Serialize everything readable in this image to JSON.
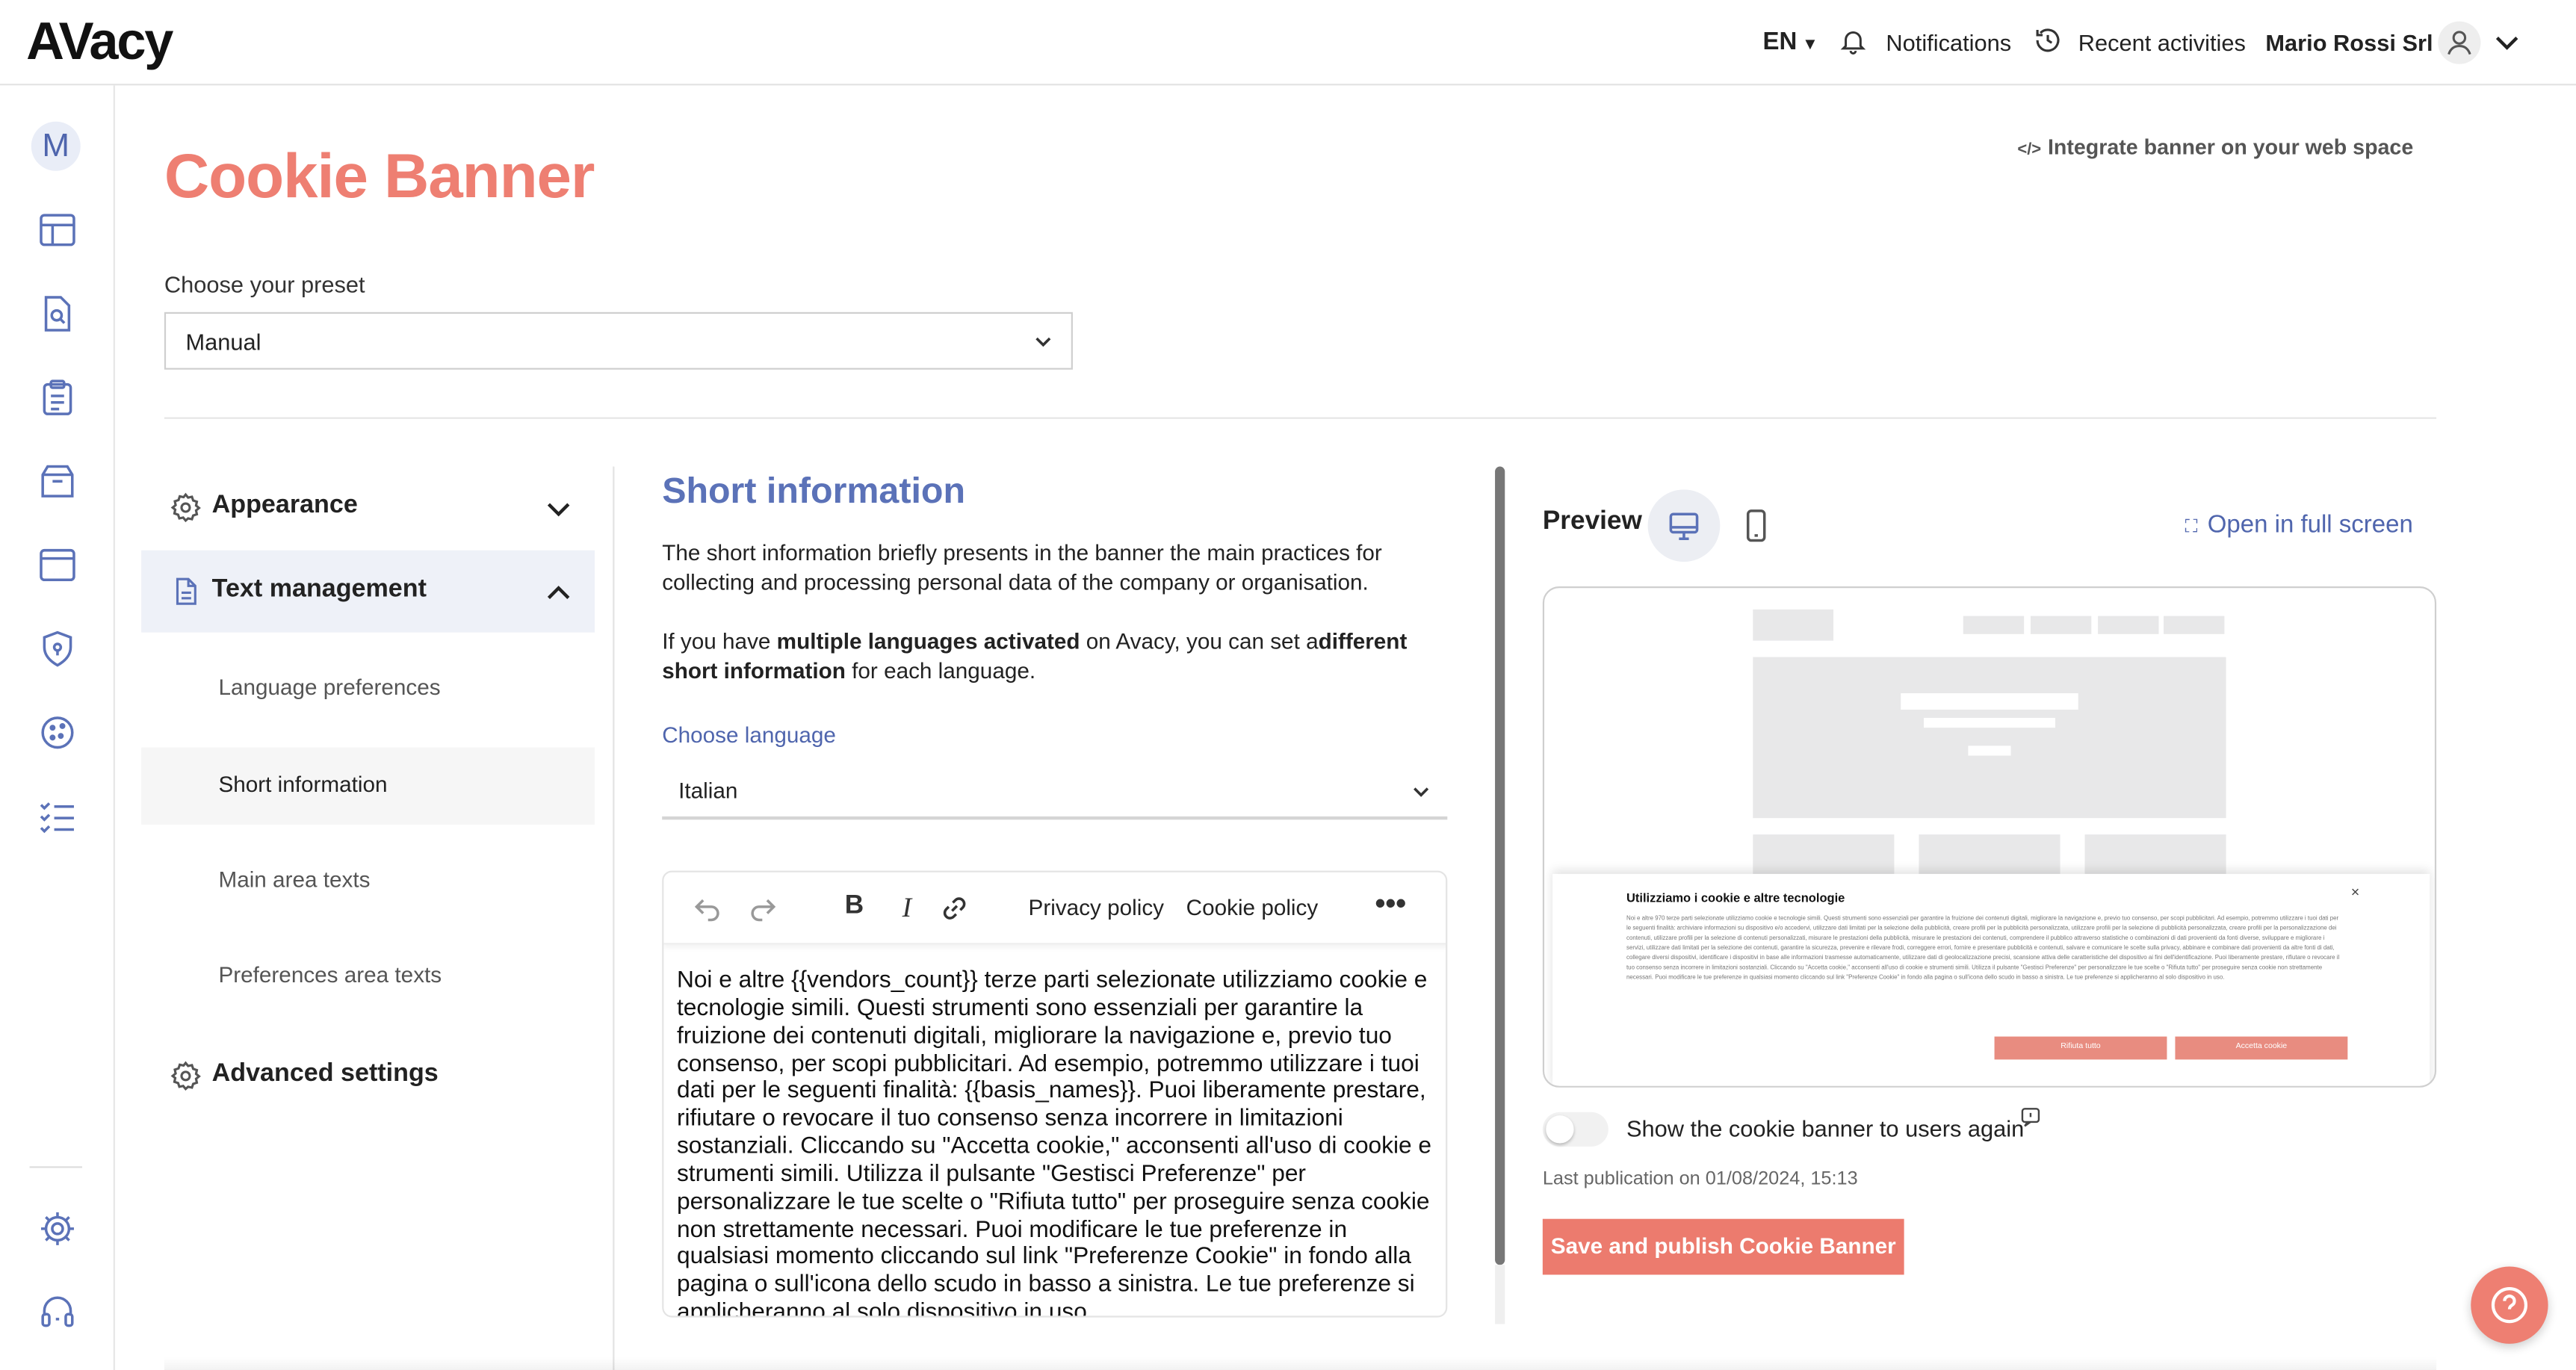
{
  "app": {
    "logo": "AVacy"
  },
  "topbar": {
    "language": "EN",
    "notifications": "Notifications",
    "recent_activities": "Recent activities",
    "company": "Mario Rossi Srl"
  },
  "sidebar": {
    "avatar_letter": "M",
    "icons": [
      "dashboard-icon",
      "document-search-icon",
      "clipboard-list-icon",
      "box-icon",
      "browser-window-icon",
      "shield-icon",
      "cookie-icon",
      "checklist-icon",
      "settings-icon",
      "headset-icon"
    ]
  },
  "page": {
    "title": "Cookie Banner",
    "integrate_link": "Integrate banner on your web space",
    "preset_label": "Choose your preset",
    "preset_value": "Manual"
  },
  "menu": {
    "appearance": "Appearance",
    "text_management": "Text management",
    "items": [
      "Language preferences",
      "Short information",
      "Main area texts",
      "Preferences area texts"
    ],
    "advanced_settings": "Advanced settings"
  },
  "short_info": {
    "title": "Short information",
    "desc": "The short information briefly presents in the banner the main practices for collecting and processing personal data of the company or organisation.",
    "multi_pre": "If you have ",
    "multi_bold1": "multiple languages activated",
    "multi_mid": " on Avacy, you can set a",
    "multi_bold2": "different short information",
    "multi_post": " for each language.",
    "choose_language": "Choose language",
    "language_value": "Italian",
    "toolbar": {
      "privacy_policy": "Privacy policy",
      "cookie_policy": "Cookie policy"
    },
    "editor_text": "Noi e altre {{vendors_count}} terze parti selezionate utilizziamo cookie e tecnologie simili. Questi strumenti sono essenziali per garantire la fruizione dei contenuti digitali, migliorare la navigazione e, previo tuo consenso, per scopi pubblicitari. Ad esempio, potremmo utilizzare i tuoi dati per le seguenti finalità: {{basis_names}}. Puoi liberamente prestare, rifiutare o revocare il tuo consenso senza incorrere in limitazioni sostanziali. Cliccando su \"Accetta cookie,\" acconsenti all'uso di cookie e strumenti simili. Utilizza il pulsante \"Gestisci Preferenze\" per personalizzare le tue scelte o \"Rifiuta tutto\" per proseguire senza cookie non strettamente necessari. Puoi modificare le tue preferenze in qualsiasi momento cliccando sul link \"Preferenze Cookie\" in fondo alla pagina o sull'icona dello scudo in basso a sinistra. Le tue preferenze si applicheranno al solo dispositivo in uso."
  },
  "preview": {
    "label": "Preview",
    "fullscreen": "Open in full screen",
    "mini_banner": {
      "title": "Utilizziamo i cookie e altre tecnologie",
      "body": "Noi e altre 970 terze parti selezionate utilizziamo cookie e tecnologie simili. Questi strumenti sono essenziali per garantire la fruizione dei contenuti digitali, migliorare la navigazione e, previo tuo consenso, per scopi pubblicitari. Ad esempio, potremmo utilizzare i tuoi dati per le seguenti finalità: archiviare informazioni su dispositivo e/o accedervi, utilizzare dati limitati per la selezione della pubblicità, creare profili per la pubblicità personalizzata, utilizzare profili per la selezione di pubblicità personalizzata, creare profili per la personalizzazione dei contenuti, utilizzare profili per la selezione di contenuti personalizzati, misurare le prestazioni della pubblicità, misurare le prestazioni dei contenuti, comprendere il pubblico attraverso statistiche o combinazioni di dati provenienti da fonti diverse, sviluppare e migliorare i servizi, utilizzare dati limitati per la selezione dei contenuti, garantire la sicurezza, prevenire e rilevare frodi, correggere errori, fornire e presentare pubblicità e contenuti, salvare e comunicare le scelte sulla privacy, abbinare e combinare dati provenienti da altre fonti di dati, collegare diversi dispositivi, identificare i dispositivi in base alle informazioni trasmesse automaticamente, utilizzare dati di geolocalizzazione precisi, scansione attiva delle caratteristiche del dispositivo ai fini dell'identificazione. Puoi liberamente prestare, rifiutare o revocare il tuo consenso senza incorrere in limitazioni sostanziali. Cliccando su \"Accetta cookie,\" acconsenti all'uso di cookie e strumenti simili. Utilizza il pulsante \"Gestisci Preferenze\" per personalizzare le tue scelte o \"Rifiuta tutto\" per proseguire senza cookie non strettamente necessari. Puoi modificare le tue preferenze in qualsiasi momento cliccando sul link \"Preferenze Cookie\" in fondo alla pagina o sull'icona dello scudo in basso a sinistra. Le tue preferenze si applicheranno al solo dispositivo in uso.",
      "reject": "Rifiuta tutto",
      "accept": "Accetta cookie"
    },
    "show_again": "Show the cookie banner to users again",
    "last_publication": "Last publication on 01/08/2024, 15:13",
    "publish_button": "Save and publish Cookie Banner"
  },
  "colors": {
    "accent": "#ee7f72",
    "primary_blue": "#5b72b8",
    "active_bg": "#eef1f8"
  }
}
